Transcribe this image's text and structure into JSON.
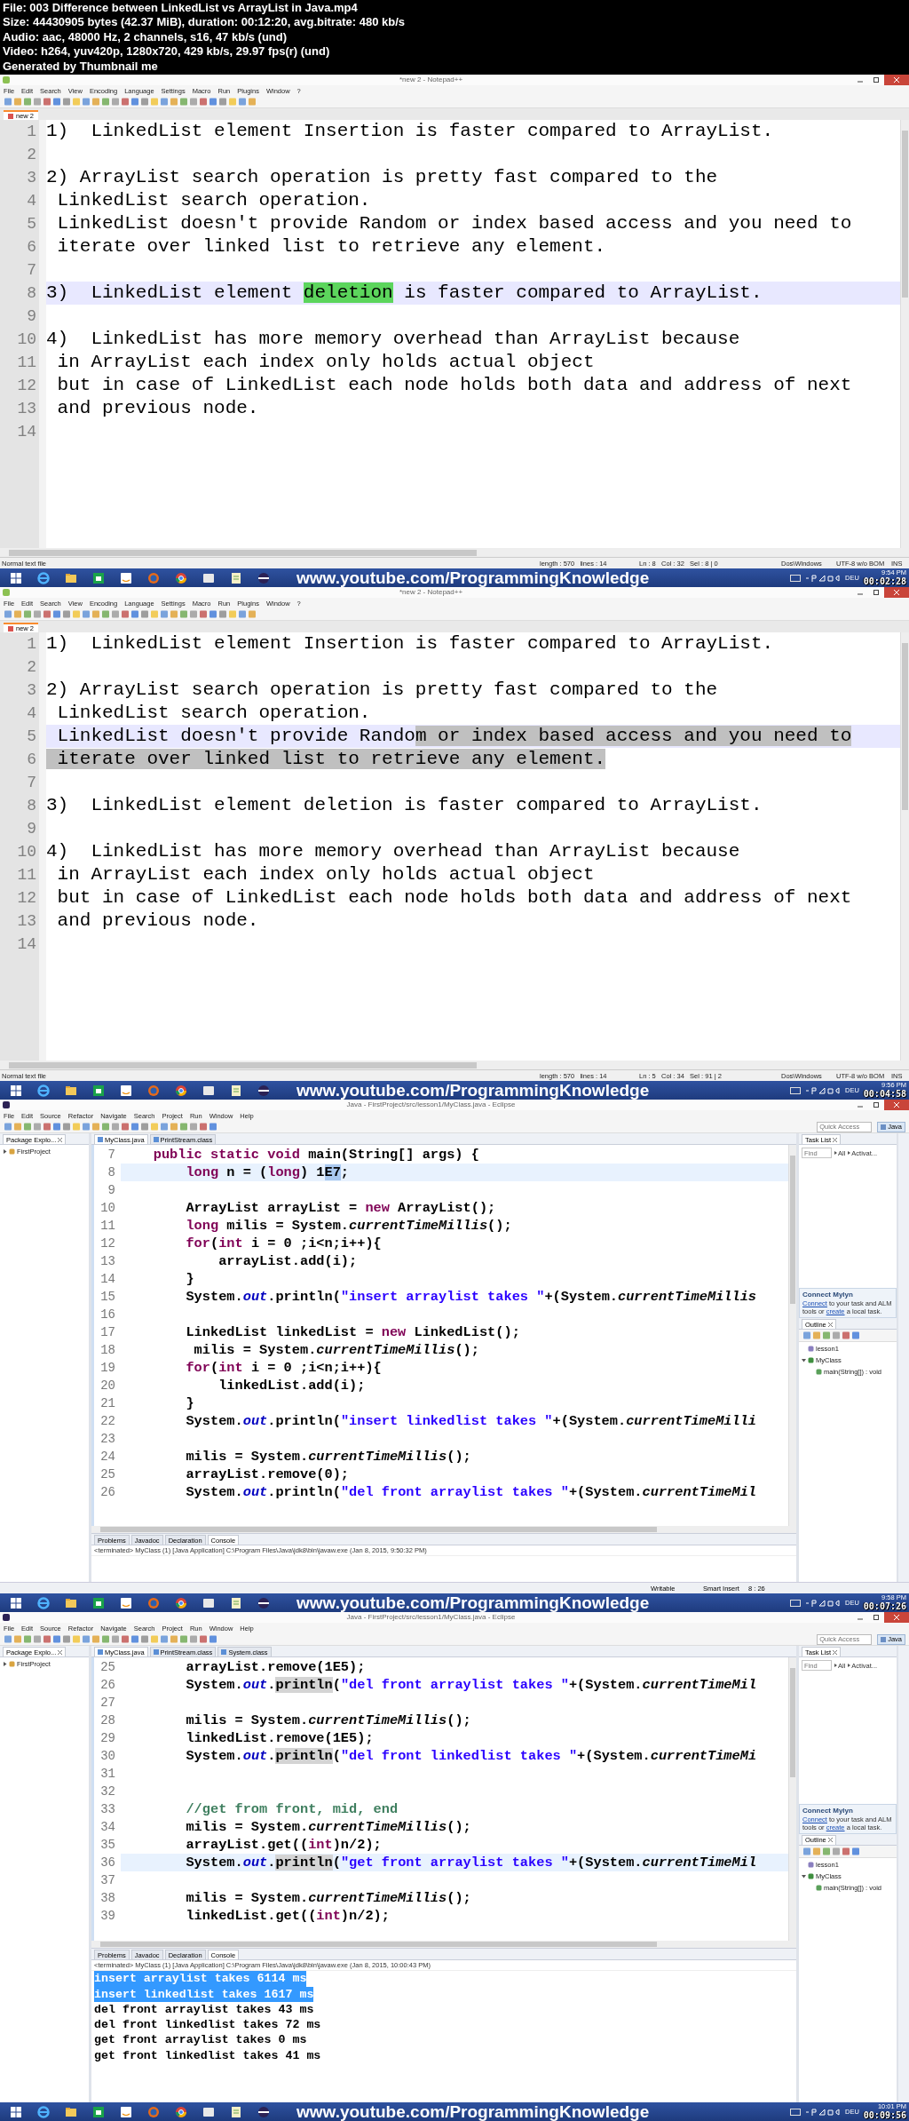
{
  "header": {
    "lines": [
      "File: 003 Difference between LinkedList vs ArrayList in Java.mp4",
      "Size: 44430905 bytes (42.37 MiB), duration: 00:12:20, avg.bitrate: 480 kb/s",
      "Audio: aac, 48000 Hz, 2 channels, s16, 47 kb/s (und)",
      "Video: h264, yuv420p, 1280x720, 429 kb/s, 29.97 fps(r) (und)",
      "Generated by Thumbnail me"
    ]
  },
  "frames": [
    {
      "kind": "notepad",
      "title": "*new 2 - Notepad++",
      "menu": [
        "File",
        "Edit",
        "Search",
        "View",
        "Encoding",
        "Language",
        "Settings",
        "Macro",
        "Run",
        "Plugins",
        "Window",
        "?"
      ],
      "tabs": [
        {
          "label": "new 2",
          "selected": true
        }
      ],
      "lines": [
        {
          "number": "1",
          "current": false,
          "text": "1)  LinkedList element Insertion is faster compared to ArrayList."
        },
        {
          "number": "2",
          "current": false
        },
        {
          "number": "3",
          "current": false,
          "text": "2) ArrayList search operation is pretty fast compared to the"
        },
        {
          "number": "4",
          "current": false,
          "text": " LinkedList search operation."
        },
        {
          "number": "5",
          "current": false,
          "text": " LinkedList doesn't provide Random or index based access and you need to"
        },
        {
          "number": "6",
          "current": false,
          "text": " iterate over linked list to retrieve any element."
        },
        {
          "number": "7",
          "current": false
        },
        {
          "number": "8",
          "current": true,
          "segments": [
            {
              "kind": "plain",
              "text": "3)  LinkedList element "
            },
            {
              "kind": "match",
              "text": "deletion"
            },
            {
              "kind": "plain",
              "text": " is faster compared to ArrayList."
            }
          ]
        },
        {
          "number": "9",
          "current": false
        },
        {
          "number": "10",
          "current": false,
          "text": "4)  LinkedList has more memory overhead than ArrayList because"
        },
        {
          "number": "11",
          "current": false,
          "text": " in ArrayList each index only holds actual object"
        },
        {
          "number": "12",
          "current": false,
          "text": " but in case of LinkedList each node holds both data and address of next"
        },
        {
          "number": "13",
          "current": false,
          "text": " and previous node."
        },
        {
          "number": "14",
          "current": false
        }
      ],
      "status": [
        "Normal text file",
        "length : 570   lines : 14",
        "Ln : 8   Col : 32   Sel : 8 | 0",
        "Dos\\Windows",
        "UTF-8 w/o BOM",
        "INS"
      ],
      "taskbar": {
        "url": "www.youtube.com/ProgrammingKnowledge",
        "language": "DEU",
        "clock": "9:54 PM",
        "timestamp": "00:02:28"
      }
    },
    {
      "kind": "notepad",
      "title": "*new 2 - Notepad++",
      "menu": [
        "File",
        "Edit",
        "Search",
        "View",
        "Encoding",
        "Language",
        "Settings",
        "Macro",
        "Run",
        "Plugins",
        "Window",
        "?"
      ],
      "tabs": [
        {
          "label": "new 2",
          "selected": true
        }
      ],
      "lines": [
        {
          "number": "1",
          "current": false,
          "text": "1)  LinkedList element Insertion is faster compared to ArrayList."
        },
        {
          "number": "2",
          "current": false
        },
        {
          "number": "3",
          "current": false,
          "text": "2) ArrayList search operation is pretty fast compared to the"
        },
        {
          "number": "4",
          "current": false,
          "text": " LinkedList search operation."
        },
        {
          "number": "5",
          "current": true,
          "segments": [
            {
              "kind": "plain",
              "text": " LinkedList doesn't provide Rando"
            },
            {
              "kind": "selection",
              "text": "m or index based access and you need to"
            }
          ]
        },
        {
          "number": "6",
          "current": false,
          "segments": [
            {
              "kind": "selection",
              "text": " iterate over linked list to retrieve any element."
            }
          ]
        },
        {
          "number": "7",
          "current": false
        },
        {
          "number": "8",
          "current": false,
          "text": "3)  LinkedList element deletion is faster compared to ArrayList."
        },
        {
          "number": "9",
          "current": false
        },
        {
          "number": "10",
          "current": false,
          "text": "4)  LinkedList has more memory overhead than ArrayList because"
        },
        {
          "number": "11",
          "current": false,
          "text": " in ArrayList each index only holds actual object"
        },
        {
          "number": "12",
          "current": false,
          "text": " but in case of LinkedList each node holds both data and address of next"
        },
        {
          "number": "13",
          "current": false,
          "text": " and previous node."
        },
        {
          "number": "14",
          "current": false
        }
      ],
      "status": [
        "Normal text file",
        "length : 570   lines : 14",
        "Ln : 5   Col : 34   Sel : 91 | 2",
        "Dos\\Windows",
        "UTF-8 w/o BOM",
        "INS"
      ],
      "taskbar": {
        "url": "www.youtube.com/ProgrammingKnowledge",
        "language": "DEU",
        "clock": "9:56 PM",
        "timestamp": "00:04:58"
      }
    },
    {
      "kind": "eclipse",
      "title": "Java - FirstProject/src/lesson1/MyClass.java - Eclipse",
      "menu": [
        "File",
        "Edit",
        "Source",
        "Refactor",
        "Navigate",
        "Search",
        "Project",
        "Run",
        "Window",
        "Help"
      ],
      "quick_access": {
        "placeholder": "Quick Access"
      },
      "perspective": "Java",
      "package_explorer": {
        "title": "Package Explo...",
        "items": [
          {
            "label": "FirstProject",
            "kind": "project",
            "expanded": false
          }
        ]
      },
      "editor_tabs": [
        {
          "label": "MyClass.java",
          "selected": true
        },
        {
          "label": "PrintStream.class",
          "selected": false
        }
      ],
      "lines": [
        {
          "number": "7",
          "current": false,
          "segments": [
            {
              "kind": "keyword",
              "text": "    public static void"
            },
            {
              "kind": "plain",
              "text": " main(String[] args) {"
            }
          ]
        },
        {
          "number": "8",
          "current": true,
          "segments": [
            {
              "kind": "keyword",
              "text": "        long"
            },
            {
              "kind": "plain",
              "text": " n = ("
            },
            {
              "kind": "keyword",
              "text": "long"
            },
            {
              "kind": "plain",
              "text": ") 1"
            },
            {
              "kind": "selection",
              "text": "E7"
            },
            {
              "kind": "plain",
              "text": ";"
            }
          ]
        },
        {
          "number": "9",
          "current": false
        },
        {
          "number": "10",
          "current": false,
          "segments": [
            {
              "kind": "plain",
              "text": "        ArrayList arrayList = "
            },
            {
              "kind": "keyword",
              "text": "new"
            },
            {
              "kind": "plain",
              "text": " ArrayList();"
            }
          ]
        },
        {
          "number": "11",
          "current": false,
          "segments": [
            {
              "kind": "keyword",
              "text": "        long"
            },
            {
              "kind": "plain",
              "text": " milis = System."
            },
            {
              "kind": "static",
              "text": "currentTimeMillis"
            },
            {
              "kind": "plain",
              "text": "();"
            }
          ]
        },
        {
          "number": "12",
          "current": false,
          "segments": [
            {
              "kind": "keyword",
              "text": "        for"
            },
            {
              "kind": "plain",
              "text": "("
            },
            {
              "kind": "keyword",
              "text": "int"
            },
            {
              "kind": "plain",
              "text": " i = 0 ;i<n;i++){"
            }
          ]
        },
        {
          "number": "13",
          "current": false,
          "text": "            arrayList.add(i);"
        },
        {
          "number": "14",
          "current": false,
          "text": "        }"
        },
        {
          "number": "15",
          "current": false,
          "segments": [
            {
              "kind": "plain",
              "text": "        System."
            },
            {
              "kind": "field",
              "text": "out"
            },
            {
              "kind": "plain",
              "text": ".println("
            },
            {
              "kind": "string",
              "text": "\"insert arraylist takes \""
            },
            {
              "kind": "plain",
              "text": "+(System."
            },
            {
              "kind": "static",
              "text": "currentTimeMillis"
            }
          ]
        },
        {
          "number": "16",
          "current": false
        },
        {
          "number": "17",
          "current": false,
          "segments": [
            {
              "kind": "plain",
              "text": "        LinkedList linkedList = "
            },
            {
              "kind": "keyword",
              "text": "new"
            },
            {
              "kind": "plain",
              "text": " LinkedList();"
            }
          ]
        },
        {
          "number": "18",
          "current": false,
          "segments": [
            {
              "kind": "plain",
              "text": "         milis = System."
            },
            {
              "kind": "static",
              "text": "currentTimeMillis"
            },
            {
              "kind": "plain",
              "text": "();"
            }
          ]
        },
        {
          "number": "19",
          "current": false,
          "segments": [
            {
              "kind": "keyword",
              "text": "        for"
            },
            {
              "kind": "plain",
              "text": "("
            },
            {
              "kind": "keyword",
              "text": "int"
            },
            {
              "kind": "plain",
              "text": " i = 0 ;i<n;i++){"
            }
          ]
        },
        {
          "number": "20",
          "current": false,
          "text": "            linkedList.add(i);"
        },
        {
          "number": "21",
          "current": false,
          "text": "        }"
        },
        {
          "number": "22",
          "current": false,
          "segments": [
            {
              "kind": "plain",
              "text": "        System."
            },
            {
              "kind": "field",
              "text": "out"
            },
            {
              "kind": "plain",
              "text": ".println("
            },
            {
              "kind": "string",
              "text": "\"insert linkedlist takes \""
            },
            {
              "kind": "plain",
              "text": "+(System."
            },
            {
              "kind": "static",
              "text": "currentTimeMilli"
            }
          ]
        },
        {
          "number": "23",
          "current": false
        },
        {
          "number": "24",
          "current": false,
          "segments": [
            {
              "kind": "plain",
              "text": "        milis = System."
            },
            {
              "kind": "static",
              "text": "currentTimeMillis"
            },
            {
              "kind": "plain",
              "text": "();"
            }
          ]
        },
        {
          "number": "25",
          "current": false,
          "text": "        arrayList.remove(0);"
        },
        {
          "number": "26",
          "current": false,
          "segments": [
            {
              "kind": "plain",
              "text": "        System."
            },
            {
              "kind": "field",
              "text": "out"
            },
            {
              "kind": "plain",
              "text": ".println("
            },
            {
              "kind": "string",
              "text": "\"del front arraylist takes \""
            },
            {
              "kind": "plain",
              "text": "+(System."
            },
            {
              "kind": "static",
              "text": "currentTimeMil"
            }
          ]
        }
      ],
      "task_list": {
        "title": "Task List",
        "find": {
          "placeholder": "Find"
        },
        "filters": [
          "All",
          "Activat..."
        ]
      },
      "mylyn": {
        "title": "Connect Mylyn",
        "text": [
          {
            "text": "Connect",
            "link": true
          },
          {
            "text": " to your task and ALM tools or ",
            "link": false
          },
          {
            "text": "create",
            "link": true
          },
          {
            "text": " a local task.",
            "link": false
          }
        ]
      },
      "outline": {
        "title": "Outline",
        "items": [
          {
            "label": "lesson1",
            "kind": "package"
          },
          {
            "label": "MyClass",
            "kind": "class",
            "expanded": true,
            "children": [
              {
                "label": "main(String[]) : void",
                "kind": "method"
              }
            ]
          }
        ]
      },
      "console": {
        "tabs": [
          {
            "label": "Problems",
            "selected": false
          },
          {
            "label": "Javadoc",
            "selected": false
          },
          {
            "label": "Declaration",
            "selected": false
          },
          {
            "label": "Console",
            "selected": true
          }
        ],
        "header": "<terminated> MyClass (1) [Java Application] C:\\Program Files\\Java\\jdk8\\bin\\javaw.exe (Jan 8, 2015, 9:50:32 PM)"
      },
      "status": [
        "Writable",
        "Smart Insert",
        "8 : 26"
      ],
      "taskbar": {
        "url": "www.youtube.com/ProgrammingKnowledge",
        "language": "DEU",
        "clock": "9:58 PM",
        "timestamp": "00:07:26"
      }
    },
    {
      "kind": "eclipse",
      "title": "Java - FirstProject/src/lesson1/MyClass.java - Eclipse",
      "menu": [
        "File",
        "Edit",
        "Source",
        "Refactor",
        "Navigate",
        "Search",
        "Project",
        "Run",
        "Window",
        "Help"
      ],
      "quick_access": {
        "placeholder": "Quick Access"
      },
      "perspective": "Java",
      "package_explorer": {
        "title": "Package Explo...",
        "items": [
          {
            "label": "FirstProject",
            "kind": "project",
            "expanded": false
          }
        ]
      },
      "editor_tabs": [
        {
          "label": "MyClass.java",
          "selected": true
        },
        {
          "label": "PrintStream.class",
          "selected": false
        },
        {
          "label": "System.class",
          "selected": false
        }
      ],
      "lines": [
        {
          "number": "25",
          "current": false,
          "text": "        arrayList.remove(1E5);"
        },
        {
          "number": "26",
          "current": false,
          "segments": [
            {
              "kind": "plain",
              "text": "        System."
            },
            {
              "kind": "field",
              "text": "out"
            },
            {
              "kind": "plain",
              "text": "."
            },
            {
              "kind": "occurrence",
              "text": "println"
            },
            {
              "kind": "plain",
              "text": "("
            },
            {
              "kind": "string",
              "text": "\"del front arraylist takes \""
            },
            {
              "kind": "plain",
              "text": "+(System."
            },
            {
              "kind": "static",
              "text": "currentTimeMil"
            }
          ]
        },
        {
          "number": "27",
          "current": false
        },
        {
          "number": "28",
          "current": false,
          "segments": [
            {
              "kind": "plain",
              "text": "        milis = System."
            },
            {
              "kind": "static",
              "text": "currentTimeMillis"
            },
            {
              "kind": "plain",
              "text": "();"
            }
          ]
        },
        {
          "number": "29",
          "current": false,
          "text": "        linkedList.remove(1E5);"
        },
        {
          "number": "30",
          "current": false,
          "segments": [
            {
              "kind": "plain",
              "text": "        System."
            },
            {
              "kind": "field",
              "text": "out"
            },
            {
              "kind": "plain",
              "text": "."
            },
            {
              "kind": "occurrence",
              "text": "println"
            },
            {
              "kind": "plain",
              "text": "("
            },
            {
              "kind": "string",
              "text": "\"del front linkedlist takes \""
            },
            {
              "kind": "plain",
              "text": "+(System."
            },
            {
              "kind": "static",
              "text": "currentTimeMi"
            }
          ]
        },
        {
          "number": "31",
          "current": false
        },
        {
          "number": "32",
          "current": false
        },
        {
          "number": "33",
          "current": false,
          "segments": [
            {
              "kind": "comment",
              "text": "        //get from front, mid, end"
            }
          ]
        },
        {
          "number": "34",
          "current": false,
          "segments": [
            {
              "kind": "plain",
              "text": "        milis = System."
            },
            {
              "kind": "static",
              "text": "currentTimeMillis"
            },
            {
              "kind": "plain",
              "text": "();"
            }
          ]
        },
        {
          "number": "35",
          "current": false,
          "segments": [
            {
              "kind": "plain",
              "text": "        arrayList.get(("
            },
            {
              "kind": "keyword",
              "text": "int"
            },
            {
              "kind": "plain",
              "text": ")n/2);"
            }
          ]
        },
        {
          "number": "36",
          "current": true,
          "segments": [
            {
              "kind": "plain",
              "text": "        System."
            },
            {
              "kind": "field",
              "text": "out"
            },
            {
              "kind": "plain",
              "text": "."
            },
            {
              "kind": "occurrence",
              "text": "println"
            },
            {
              "kind": "plain",
              "text": "("
            },
            {
              "kind": "string",
              "text": "\"get front arraylist takes \""
            },
            {
              "kind": "plain",
              "text": "+(System."
            },
            {
              "kind": "static",
              "text": "currentTimeMil"
            }
          ]
        },
        {
          "number": "37",
          "current": false
        },
        {
          "number": "38",
          "current": false,
          "segments": [
            {
              "kind": "plain",
              "text": "        milis = System."
            },
            {
              "kind": "static",
              "text": "currentTimeMillis"
            },
            {
              "kind": "plain",
              "text": "();"
            }
          ]
        },
        {
          "number": "39",
          "current": false,
          "segments": [
            {
              "kind": "plain",
              "text": "        linkedList.get(("
            },
            {
              "kind": "keyword",
              "text": "int"
            },
            {
              "kind": "plain",
              "text": ")n/2);"
            }
          ]
        }
      ],
      "task_list": {
        "title": "Task List",
        "find": {
          "placeholder": "Find"
        },
        "filters": [
          "All",
          "Activat..."
        ]
      },
      "mylyn": {
        "title": "Connect Mylyn",
        "text": [
          {
            "text": "Connect",
            "link": true
          },
          {
            "text": " to your task and ALM tools or ",
            "link": false
          },
          {
            "text": "create",
            "link": true
          },
          {
            "text": " a local task.",
            "link": false
          }
        ]
      },
      "outline": {
        "title": "Outline",
        "items": [
          {
            "label": "lesson1",
            "kind": "package"
          },
          {
            "label": "MyClass",
            "kind": "class",
            "expanded": true,
            "children": [
              {
                "label": "main(String[]) : void",
                "kind": "method"
              }
            ]
          }
        ]
      },
      "console": {
        "tabs": [
          {
            "label": "Problems",
            "selected": false
          },
          {
            "label": "Javadoc",
            "selected": false
          },
          {
            "label": "Declaration",
            "selected": false
          },
          {
            "label": "Console",
            "selected": true
          }
        ],
        "header": "<terminated> MyClass (1) [Java Application] C:\\Program Files\\Java\\jdk8\\bin\\javaw.exe (Jan 8, 2015, 10:00:43 PM)",
        "output": [
          {
            "text": "insert arraylist takes 6114 ms",
            "selected": true
          },
          {
            "text": "insert linkedlist takes 1617 ms",
            "selected": true
          },
          {
            "text": "del front arraylist takes 43 ms",
            "selected": false
          },
          {
            "text": "del front linkedlist takes 72 ms",
            "selected": false
          },
          {
            "text": "get front arraylist takes 0 ms",
            "selected": false
          },
          {
            "text": "get front linkedlist takes 41 ms",
            "selected": false
          }
        ]
      },
      "taskbar": {
        "url": "www.youtube.com/ProgrammingKnowledge",
        "language": "DEU",
        "clock": "10:01 PM",
        "timestamp": "00:09:56"
      }
    }
  ]
}
